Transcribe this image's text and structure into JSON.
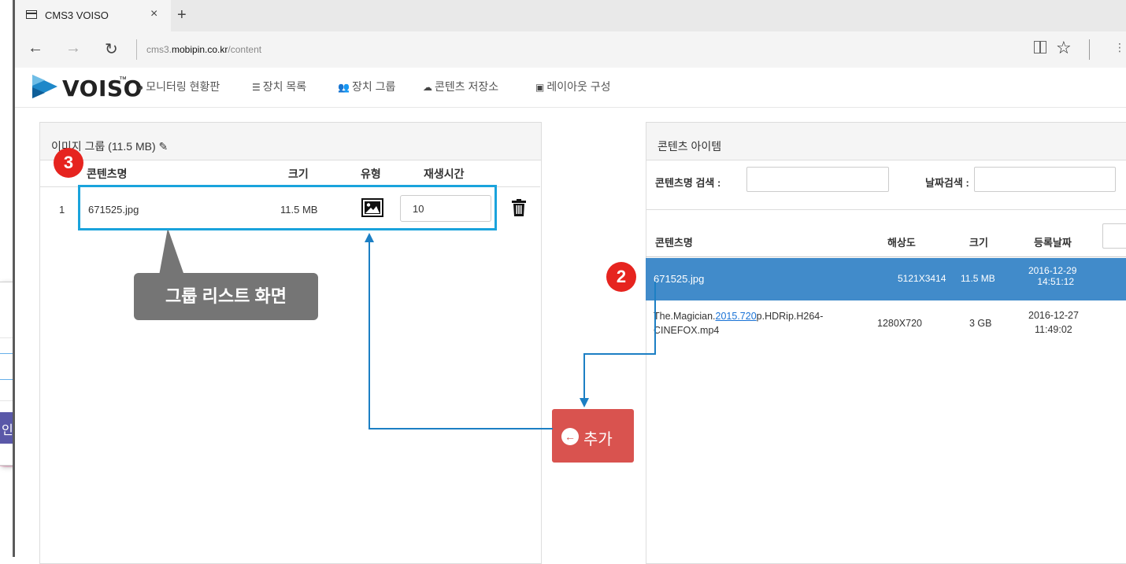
{
  "background_dialog": {
    "close_icon": "×",
    "input_clear_icon": "×",
    "confirm_button_label": "인"
  },
  "browser": {
    "tab_title": "CMS3 VOISO",
    "tab_close": "×",
    "new_tab": "+",
    "url_host_prefix": "cms3.",
    "url_host_main": "mobipin.co.kr",
    "url_path": "/content",
    "back": "←",
    "forward": "→",
    "refresh": "↻",
    "favorite": "☆",
    "more": "⋮"
  },
  "app": {
    "brand": "VOISO",
    "brand_tm": "™",
    "menu": [
      {
        "icon": "dashboard-icon",
        "glyph": "◕",
        "label": "모니터링 현황판"
      },
      {
        "icon": "list-icon",
        "glyph": "☰",
        "label": "장치 목록"
      },
      {
        "icon": "users-icon",
        "glyph": "👥",
        "label": "장치 그룹"
      },
      {
        "icon": "cloud-upload-icon",
        "glyph": "☁",
        "label": "콘텐츠 저장소"
      },
      {
        "icon": "layout-icon",
        "glyph": "▣",
        "label": "레이아웃 구성"
      }
    ]
  },
  "group_panel": {
    "title": "이미지 그룹 (11.5 MB)",
    "columns": {
      "name": "콘텐츠명",
      "size": "크기",
      "type": "유형",
      "duration": "재생시간"
    },
    "rows": [
      {
        "index": "1",
        "name": "671525.jpg",
        "size": "11.5 MB",
        "type_icon": "image-icon",
        "duration": "10"
      }
    ]
  },
  "content_panel": {
    "title": "콘텐츠 아이템",
    "search_name_label": "콘텐츠명 검색 :",
    "search_date_label": "날짜검색 :",
    "columns": {
      "name": "콘텐츠명",
      "resolution": "해상도",
      "size": "크기",
      "date": "등록날짜"
    },
    "rows": [
      {
        "name": "671525.jpg",
        "resolution": "5121X3414",
        "size": "11.5 MB",
        "date1": "2016-12-29",
        "date2": "14:51:12",
        "selected": true
      },
      {
        "name_pre": "The.Magician.",
        "name_link": "2015.720",
        "name_post": "p.HDRip.H264-",
        "name_line2": "CINEFOX.mp4",
        "resolution": "1280X720",
        "size": "3 GB",
        "date1": "2016-12-27",
        "date2": "11:49:02",
        "selected": false
      }
    ]
  },
  "add_button": {
    "label": "추가",
    "icon": "arrow-circle-left-icon"
  },
  "annotations": {
    "badge_2": "2",
    "badge_3": "3",
    "callout": "그룹 리스트 화면"
  },
  "colors": {
    "selected_row": "#418bca",
    "add_button": "#d9534f",
    "highlight": "#1aa3dc",
    "badge": "#e6241f",
    "callout": "#757575",
    "confirm_button": "#5a58a8"
  }
}
